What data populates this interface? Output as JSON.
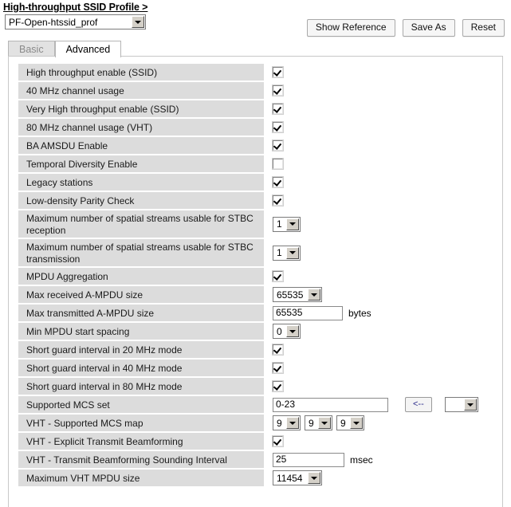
{
  "header": {
    "title": "High-throughput SSID Profile >",
    "profile_value": "PF-Open-htssid_prof",
    "buttons": [
      {
        "label": "Show Reference"
      },
      {
        "label": "Save As"
      },
      {
        "label": "Reset"
      }
    ]
  },
  "tabs": [
    {
      "label": "Basic",
      "active": false
    },
    {
      "label": "Advanced",
      "active": true
    }
  ],
  "rows": [
    {
      "label": "High throughput enable (SSID)",
      "type": "checkbox",
      "checked": true
    },
    {
      "label": "40 MHz channel usage",
      "type": "checkbox",
      "checked": true
    },
    {
      "label": "Very High throughput enable (SSID)",
      "type": "checkbox",
      "checked": true
    },
    {
      "label": "80 MHz channel usage (VHT)",
      "type": "checkbox",
      "checked": true
    },
    {
      "label": "BA AMSDU Enable",
      "type": "checkbox",
      "checked": true
    },
    {
      "label": "Temporal Diversity Enable",
      "type": "checkbox",
      "checked": false
    },
    {
      "label": "Legacy stations",
      "type": "checkbox",
      "checked": true
    },
    {
      "label": "Low-density Parity Check",
      "type": "checkbox",
      "checked": true
    },
    {
      "label": "Maximum number of spatial streams usable for STBC reception",
      "type": "select",
      "value": "1"
    },
    {
      "label": "Maximum number of spatial streams usable for STBC transmission",
      "type": "select",
      "value": "1"
    },
    {
      "label": "MPDU Aggregation",
      "type": "checkbox",
      "checked": true
    },
    {
      "label": "Max received A-MPDU size",
      "type": "select",
      "value": "65535"
    },
    {
      "label": "Max transmitted A-MPDU size",
      "type": "text",
      "value": "65535",
      "unit": "bytes"
    },
    {
      "label": "Min MPDU start spacing",
      "type": "select",
      "value": "0"
    },
    {
      "label": "Short guard interval in 20 MHz mode",
      "type": "checkbox",
      "checked": true
    },
    {
      "label": "Short guard interval in 40 MHz mode",
      "type": "checkbox",
      "checked": true
    },
    {
      "label": "Short guard interval in 80 MHz mode",
      "type": "checkbox",
      "checked": true
    },
    {
      "label": "Supported MCS set",
      "type": "mcs",
      "value": "0-23",
      "button_label": "<--",
      "select_value": ""
    },
    {
      "label": "VHT - Supported MCS map",
      "type": "triple-select",
      "values": [
        "9",
        "9",
        "9"
      ]
    },
    {
      "label": "VHT - Explicit Transmit Beamforming",
      "type": "checkbox",
      "checked": true
    },
    {
      "label": "VHT - Transmit Beamforming Sounding Interval",
      "type": "text",
      "value": "25",
      "unit": "msec"
    },
    {
      "label": "Maximum VHT MPDU size",
      "type": "select",
      "value": "11454"
    }
  ]
}
